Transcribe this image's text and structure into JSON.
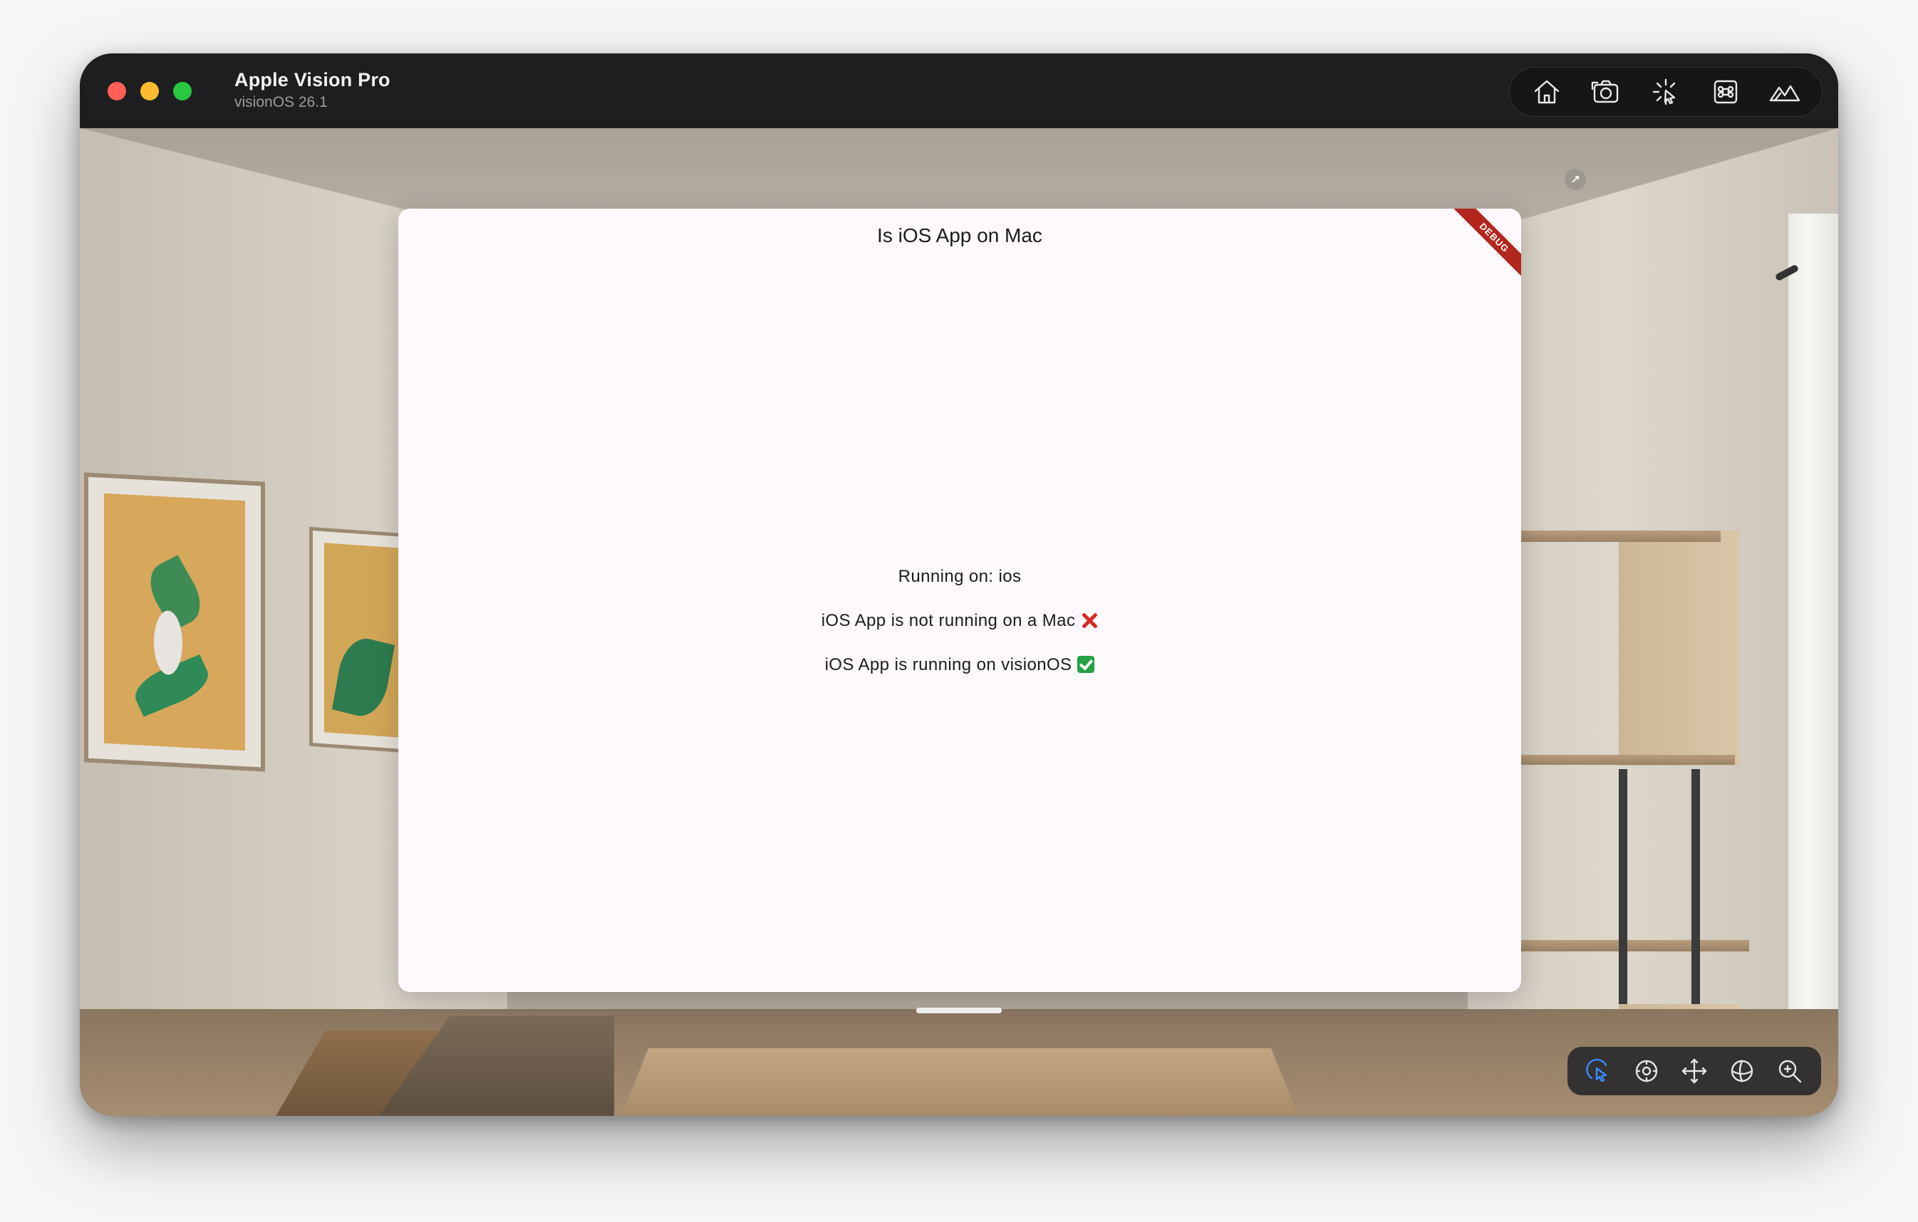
{
  "window": {
    "title": "Apple Vision Pro",
    "subtitle": "visionOS 26.1"
  },
  "toolbar": {
    "icons": [
      "home-icon",
      "screenshot-camera-icon",
      "interaction-pointer-icon",
      "command-key-icon",
      "environment-mountains-icon"
    ]
  },
  "app": {
    "title": "Is iOS App on Mac",
    "debug_banner": "DEBUG",
    "lines": [
      "Running on: ios",
      "iOS App is not running on a Mac",
      "iOS App is running on visionOS"
    ],
    "line_marks": [
      "",
      "cross-mark-icon",
      "check-mark-icon"
    ],
    "background": "#fdf9fd"
  },
  "navigation": {
    "tools": [
      "select-pointer-icon",
      "look-around-icon",
      "pan-move-icon",
      "orbit-icon",
      "zoom-icon"
    ],
    "active_tool": "select-pointer-icon",
    "accent": "#3b8cff",
    "camera_reset": "camera-reset-icon"
  },
  "colors": {
    "traffic_red": "#ff5f57",
    "traffic_yellow": "#febc2e",
    "traffic_green": "#28c840",
    "debug_red": "#b3261e"
  }
}
